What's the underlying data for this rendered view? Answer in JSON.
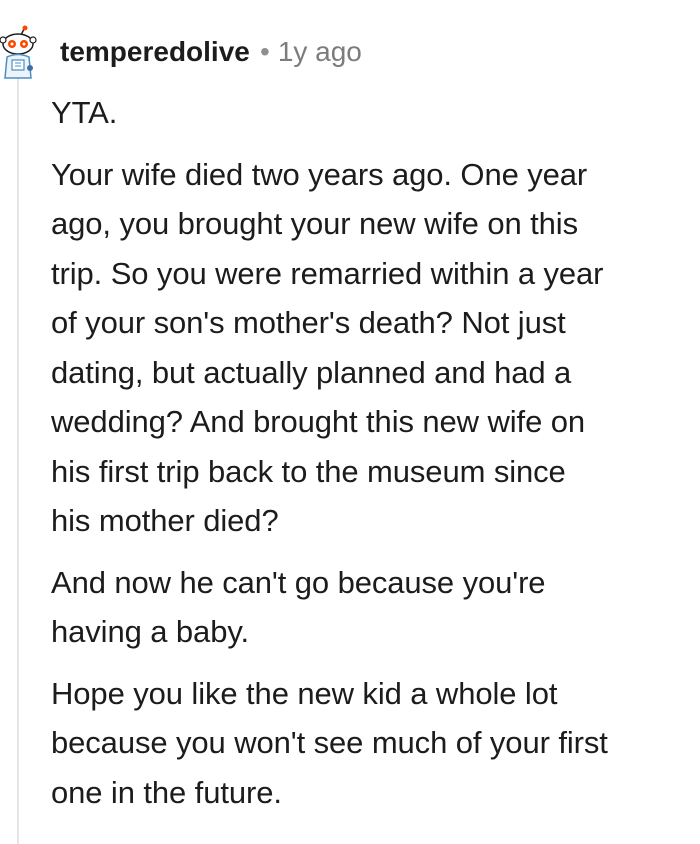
{
  "comment": {
    "username": "temperedolive",
    "separator": "•",
    "timestamp": "1y ago",
    "paragraphs": [
      "YTA.",
      "Your wife died two years ago. One year\nago, you brought your new wife on this\ntrip. So you were remarried within a year\nof your son's mother's death? Not just\ndating, but actually planned and had a\nwedding? And brought this new wife on\nhis first trip back to the museum since\nhis mother died?",
      "And now he can't go because you're\nhaving a baby.",
      "Hope you like the new kid a whole lot\nbecause you won't see much of your first\none in the future."
    ]
  },
  "icons": {
    "avatar": "snoo-avatar-icon"
  },
  "colors": {
    "text": "#1c1c1c",
    "meta": "#7c7c7c",
    "thread_line": "#e3e6e8"
  }
}
